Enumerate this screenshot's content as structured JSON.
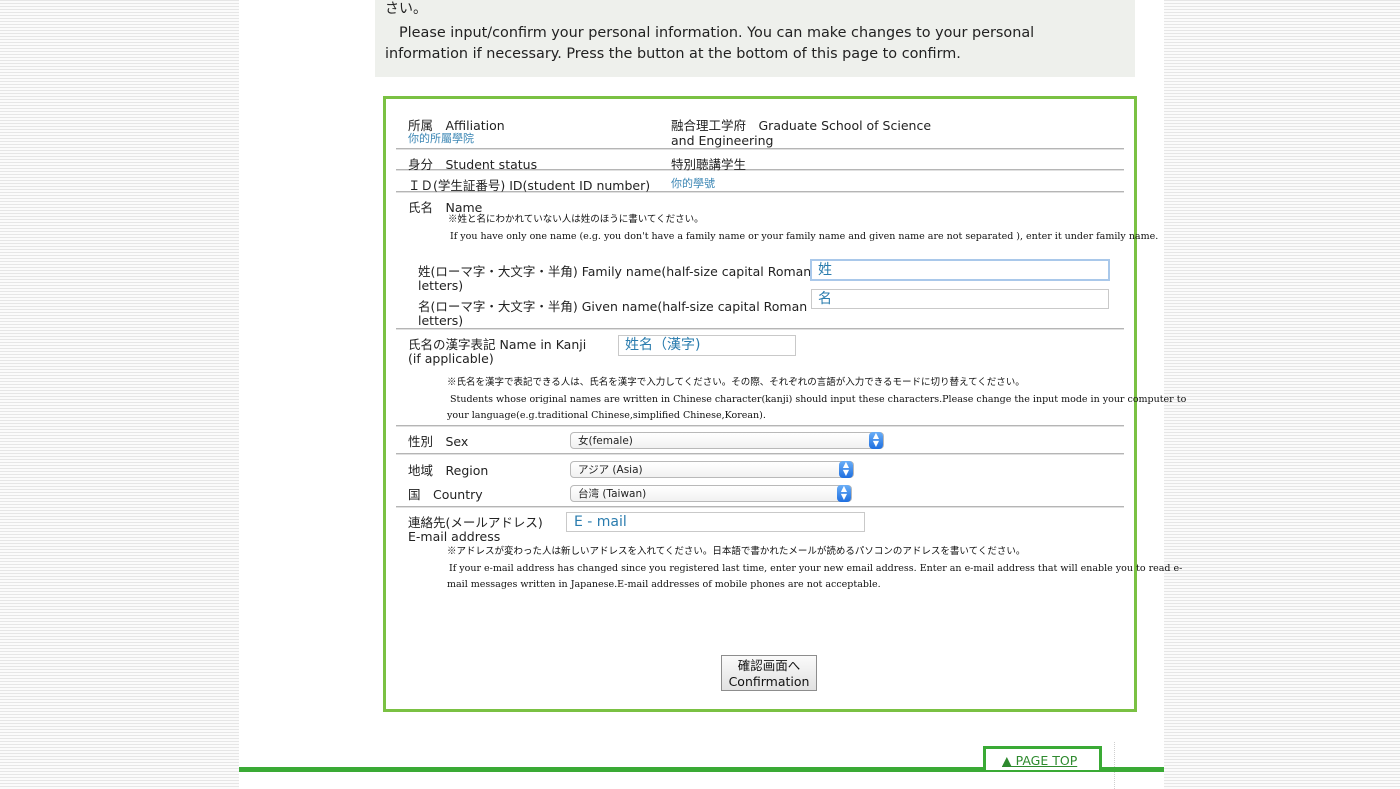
{
  "notice": {
    "line1": "さい。",
    "line2": "Please input/confirm your personal information. You can make changes to your personal information if necessary. Press the button at the bottom of this page to confirm."
  },
  "form": {
    "affiliation": {
      "label": "所属　Affiliation",
      "hint": "你的所屬學院",
      "value_line1": "融合理工学府　Graduate School of Science",
      "value_line2": "and Engineering"
    },
    "status": {
      "label": "身分　Student status",
      "value": "特別聴講学生"
    },
    "student_id": {
      "label": "ＩＤ(学生証番号) ID(student ID number)",
      "value": "你的學號"
    },
    "name": {
      "label": "氏名　Name",
      "note_jp": "※姓と名にわかれていない人は姓のほうに書いてください。",
      "note_en": "If you have only one name (e.g. you don't have a family name or your family name and given name are not separated ), enter it under family name.",
      "family_label_line1": "姓(ローマ字・大文字・半角) Family name(half-size capital Roman",
      "family_label_line2": "letters)",
      "family_value": "姓",
      "given_label_line1": "名(ローマ字・大文字・半角) Given name(half-size capital Roman",
      "given_label_line2": "letters)",
      "given_value": "名"
    },
    "kanji": {
      "label_line1": "氏名の漢字表記 Name in Kanji",
      "label_line2": "(if applicable)",
      "value": "姓名（漢字)",
      "note_jp": "※氏名を漢字で表記できる人は、氏名を漢字で入力してください。その際、それぞれの言語が入力できるモードに切り替えてください。",
      "note_en1": "Students whose original names are written in Chinese character(kanji) should input these characters.Please change the input mode in your computer to",
      "note_en2": "your language(e.g.traditional Chinese,simplified Chinese,Korean)."
    },
    "sex": {
      "label": "性別　Sex",
      "selected": "女(female)"
    },
    "region": {
      "label": "地域　Region",
      "selected": "アジア (Asia)"
    },
    "country": {
      "label": "国　Country",
      "selected": "台湾 (Taiwan)"
    },
    "email": {
      "label_line1": "連絡先(メールアドレス)",
      "label_line2": "E-mail address",
      "value": "E - mail",
      "note_jp": "※アドレスが変わった人は新しいアドレスを入れてください。日本語で書かれたメールが読めるパソコンのアドレスを書いてください。",
      "note_en1": "If your e-mail address has changed since you registered last time, enter your new email address. Enter an e-mail address that will enable you to read e-",
      "note_en2": "mail messages written in Japanese.E-mail addresses of mobile phones are not acceptable."
    },
    "confirm_button": {
      "line1": "確認画面へ",
      "line2": "Confirmation"
    }
  },
  "footer": {
    "page_top": "▲ PAGE TOP"
  },
  "colors": {
    "border_green": "#7ac143",
    "footer_green": "#3aaa35",
    "hint_blue": "#3b86b4",
    "notice_bg": "#eef0ec"
  },
  "icons": {
    "select_arrow": "updown-chevron-icon",
    "page_top_arrow": "triangle-up-icon"
  }
}
